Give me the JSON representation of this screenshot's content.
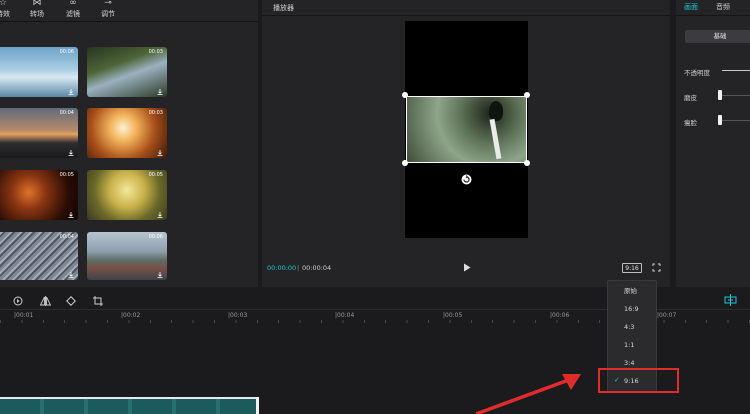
{
  "toolbar": {
    "tabs": [
      {
        "label": "特效",
        "icon": "effects-icon"
      },
      {
        "label": "转场",
        "icon": "transition-icon"
      },
      {
        "label": "滤镜",
        "icon": "filter-icon"
      },
      {
        "label": "调节",
        "icon": "adjust-icon"
      }
    ]
  },
  "media": {
    "thumbs": [
      {
        "duration": "00:06"
      },
      {
        "duration": "00:03"
      },
      {
        "duration": "00:04"
      },
      {
        "duration": "00:03"
      },
      {
        "duration": "00:05"
      },
      {
        "duration": "00:05"
      },
      {
        "duration": "00:04"
      },
      {
        "duration": "00:06"
      }
    ]
  },
  "player": {
    "title": "播放器",
    "current_time": "00:00:00",
    "separator": "|",
    "total_time": "00:00:04",
    "ratio_label": "9:16"
  },
  "ratio_menu": {
    "options": [
      "原始",
      "16:9",
      "4:3",
      "1:1",
      "3:4",
      "9:16"
    ],
    "selected": "9:16"
  },
  "right_panel": {
    "tabs": [
      "画面",
      "音频"
    ],
    "active_tab": "画面",
    "section_button": "基础",
    "opacity_label": "不透明度",
    "slider1_label": "磨皮",
    "slider2_label": "瘦脸"
  },
  "timeline": {
    "ticks": [
      "|00:01",
      "|00:02",
      "|00:03",
      "|00:04",
      "|00:05",
      "|00:06",
      "|00:07"
    ]
  },
  "colors": {
    "accent": "#1fc3d8",
    "highlight": "#e12c2c",
    "background": "#1b1b1d",
    "panel": "#242427"
  }
}
